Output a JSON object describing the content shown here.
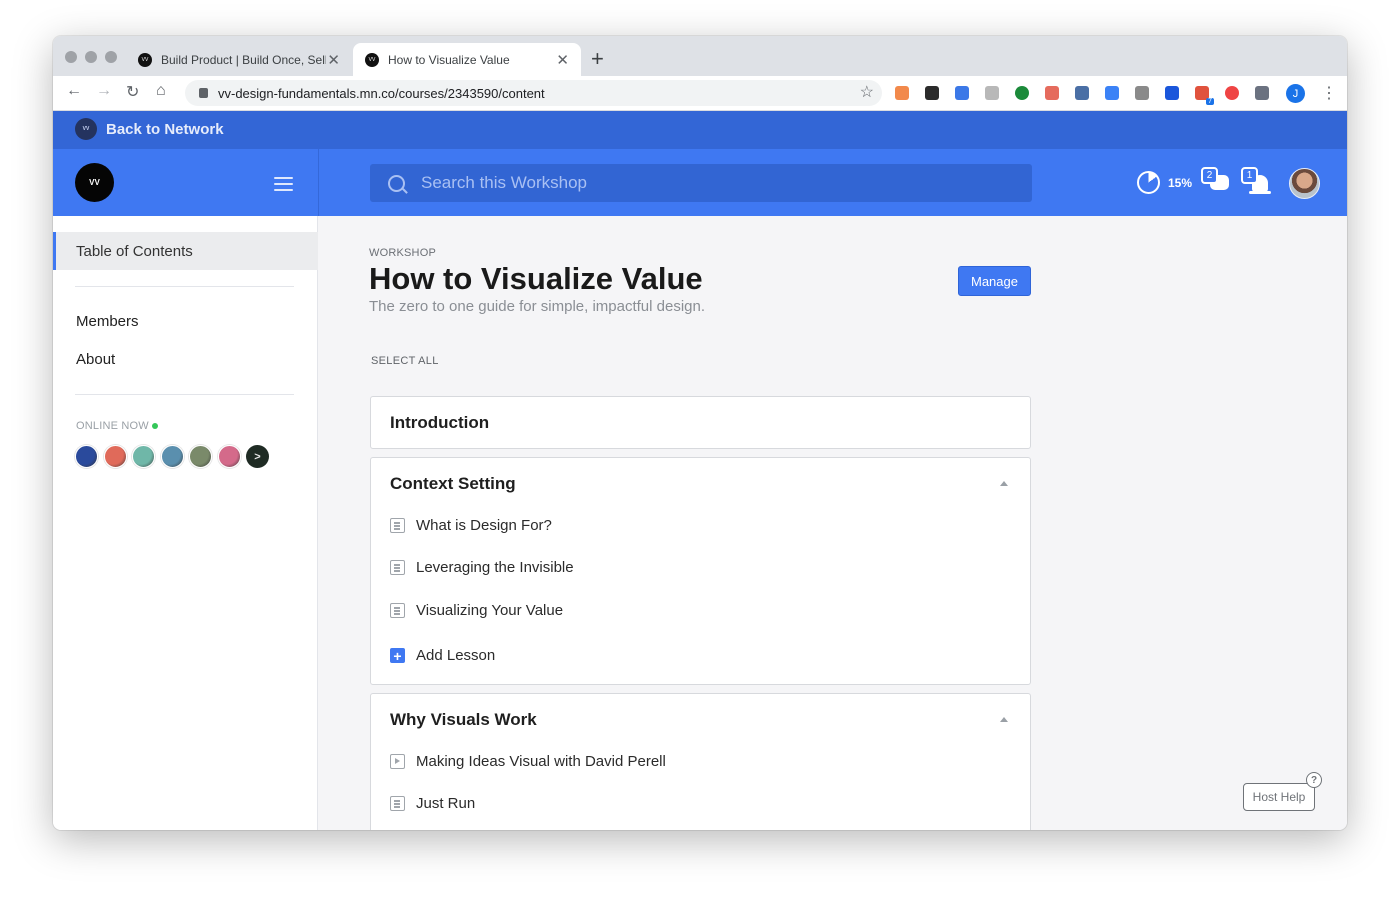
{
  "browser": {
    "tabs": [
      {
        "title": "Build Product | Build Once, Sell",
        "favicon": "vv-logo"
      },
      {
        "title": "How to Visualize Value",
        "favicon": "vv-logo"
      }
    ],
    "url": "vv-design-fundamentals.mn.co/courses/2343590/content",
    "profile_initial": "J",
    "extension_colors": [
      "#f2894b",
      "#2b2b2b",
      "#3b78e7",
      "#b8b8b8",
      "#1b8a3a",
      "#e56b5d",
      "#4a6fa5",
      "#3b82f6",
      "#8a8a8a",
      "#1a56db",
      "#e0523d",
      "#ef4444",
      "#6b7280"
    ],
    "extension_badge": "7"
  },
  "app": {
    "back_to_network": "Back to Network",
    "logo_text": "VV",
    "search_placeholder": "Search this Workshop",
    "progress": "15%",
    "progress_value": 0.15,
    "messages_count": "2",
    "notifications_count": "1"
  },
  "sidebar": {
    "toc_label": "Table of Contents",
    "links": [
      "Members",
      "About"
    ],
    "online_now_label": "ONLINE NOW",
    "online_dot_color": "#34c759",
    "online_avatar_colors": [
      "#2a4a9c",
      "#e06a5a",
      "#6fb7a8",
      "#5a8fae",
      "#7a8a6a",
      "#d46a8a"
    ],
    "online_more": ">"
  },
  "main": {
    "eyebrow": "WORKSHOP",
    "title": "How to Visualize Value",
    "subtitle": "The zero to one guide for simple, impactful design.",
    "manage_label": "Manage",
    "select_all_label": "SELECT ALL",
    "sections": [
      {
        "title": "Introduction",
        "lessons": []
      },
      {
        "title": "Context Setting",
        "lessons": [
          {
            "title": "What is Design For?",
            "icon": "document-icon"
          },
          {
            "title": "Leveraging the Invisible",
            "icon": "document-icon"
          },
          {
            "title": "Visualizing Your Value",
            "icon": "document-icon"
          }
        ],
        "add_lesson_label": "Add Lesson"
      },
      {
        "title": "Why Visuals Work",
        "lessons": [
          {
            "title": "Making Ideas Visual with David Perell",
            "icon": "video-icon"
          },
          {
            "title": "Just Run",
            "icon": "document-icon"
          }
        ]
      }
    ],
    "host_help_label": "Host Help",
    "host_help_icon": "?"
  },
  "colors": {
    "brand_blue": "#3f78f2",
    "network_bar": "#3366d6"
  }
}
